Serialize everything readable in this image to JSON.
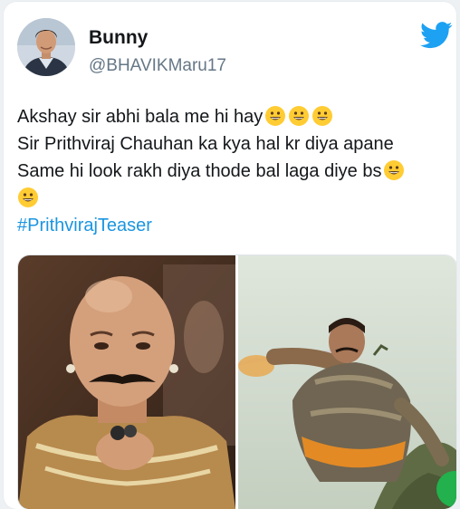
{
  "tweet": {
    "author_name": "Bunny",
    "author_handle": "@BHAVIKMaru17",
    "lines": [
      "Akshay sir abhi bala me hi hay",
      "Sir Prithviraj Chauhan ka kya hal kr diya apane",
      "Same hi look rakh diya thode bal laga diye bs"
    ],
    "hashtag": "#PrithvirajTeaser"
  },
  "icons": {
    "brand": "twitter-bird-icon",
    "emoji": "grinning-face-emoji"
  },
  "colors": {
    "twitter_blue": "#1da1f2",
    "hashtag": "#1b95e0",
    "text": "#14171a",
    "handle": "#657786",
    "emoji_yellow": "#ffcc33"
  }
}
